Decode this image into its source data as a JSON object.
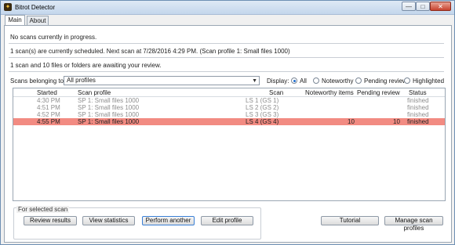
{
  "window": {
    "title": "Bitrot Detector",
    "controls": {
      "minimize": "—",
      "maximize": "□",
      "close": "✕"
    }
  },
  "tabs": [
    {
      "label": "Main",
      "active": true
    },
    {
      "label": "About",
      "active": false
    }
  ],
  "status": {
    "progress": "No scans currently in progress.",
    "scheduled": "1 scan(s) are currently scheduled.  Next scan at 7/28/2016 4:29 PM.  (Scan profile 1: Small files 1000)",
    "review": "1 scan and 10 files or folders are awaiting your review."
  },
  "filter": {
    "label": "Scans belonging to:",
    "selected": "All profiles",
    "display_label": "Display:",
    "options": [
      {
        "label": "All",
        "selected": true
      },
      {
        "label": "Noteworthy",
        "selected": false
      },
      {
        "label": "Pending review",
        "selected": false
      },
      {
        "label": "Highlighted",
        "selected": false
      }
    ]
  },
  "table": {
    "columns": [
      "Started",
      "Scan profile",
      "Scan",
      "Noteworthy items",
      "Pending review",
      "Status"
    ],
    "rows": [
      {
        "started": "4:30 PM",
        "profile": "SP 1: Small files 1000",
        "scan": "LS 1 (GS 1)",
        "noteworthy": "",
        "pending": "",
        "status": "finished"
      },
      {
        "started": "4:51 PM",
        "profile": "SP 1: Small files 1000",
        "scan": "LS 2 (GS 2)",
        "noteworthy": "",
        "pending": "",
        "status": "finished"
      },
      {
        "started": "4:52 PM",
        "profile": "SP 1: Small files 1000",
        "scan": "LS 3 (GS 3)",
        "noteworthy": "",
        "pending": "",
        "status": "finished"
      },
      {
        "started": "4:55 PM",
        "profile": "SP 1: Small files 1000",
        "scan": "LS 4 (GS 4)",
        "noteworthy": "10",
        "pending": "10",
        "status": "finished"
      }
    ]
  },
  "selected_scan": {
    "group_label": "For selected scan",
    "buttons": [
      "Review results",
      "View statistics",
      "Perform another",
      "Edit profile"
    ]
  },
  "footer": {
    "tutorial": "Tutorial",
    "manage": "Manage scan profiles"
  },
  "colors": {
    "highlight_row": "#f28b82",
    "dim_text": "#8e8e8e"
  }
}
